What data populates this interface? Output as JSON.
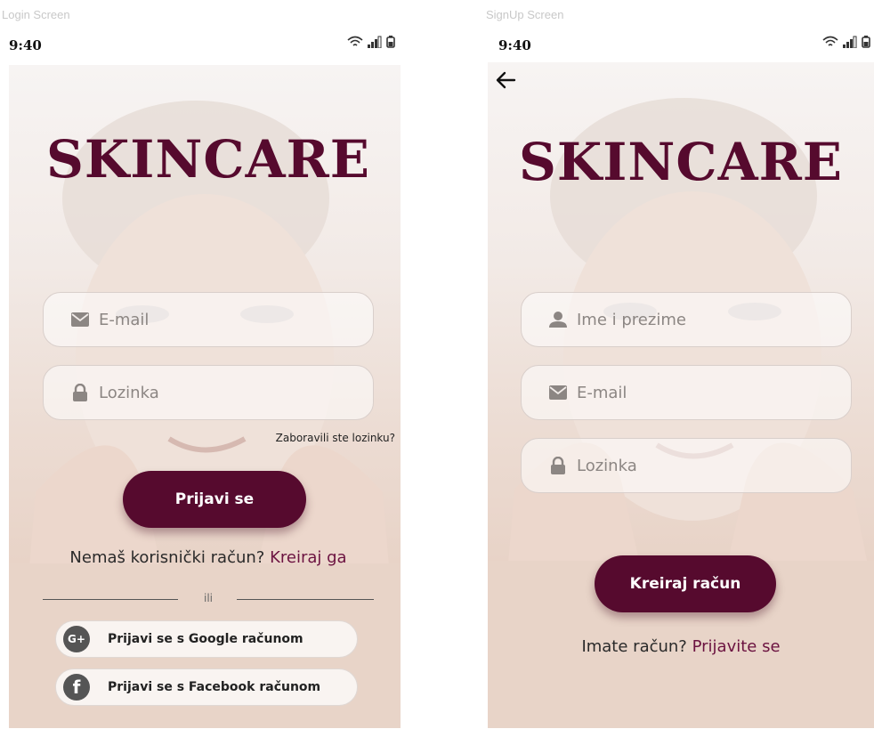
{
  "login_screen": {
    "screen_label": "Login Screen",
    "status_time": "9:40",
    "brand": "SKINCARE",
    "email_placeholder": "E-mail",
    "password_placeholder": "Lozinka",
    "forgot_password": "Zaboravili ste lozinku?",
    "login_button": "Prijavi se",
    "no_account_text": "Nemaš korisnički račun?",
    "create_link": "Kreiraj ga",
    "or_text": "ili",
    "google_button": "Prijavi se s Google računom",
    "facebook_button": "Prijavi se s Facebook računom",
    "google_icon_glyph": "G+",
    "facebook_icon_glyph": "f"
  },
  "signup_screen": {
    "screen_label": "SignUp Screen",
    "status_time": "9:40",
    "brand": "SKINCARE",
    "name_placeholder": "Ime i prezime",
    "email_placeholder": "E-mail",
    "password_placeholder": "Lozinka",
    "create_button": "Kreiraj račun",
    "have_account_text": "Imate račun?",
    "login_link": "Prijavite se"
  },
  "colors": {
    "brand": "#560a2e",
    "link": "#6b1240",
    "icon_gray": "#8c8683"
  },
  "icons": [
    "wifi-icon",
    "signal-icon",
    "battery-icon",
    "mail-icon",
    "lock-icon",
    "person-icon",
    "google-plus-icon",
    "facebook-icon",
    "back-arrow-icon"
  ]
}
